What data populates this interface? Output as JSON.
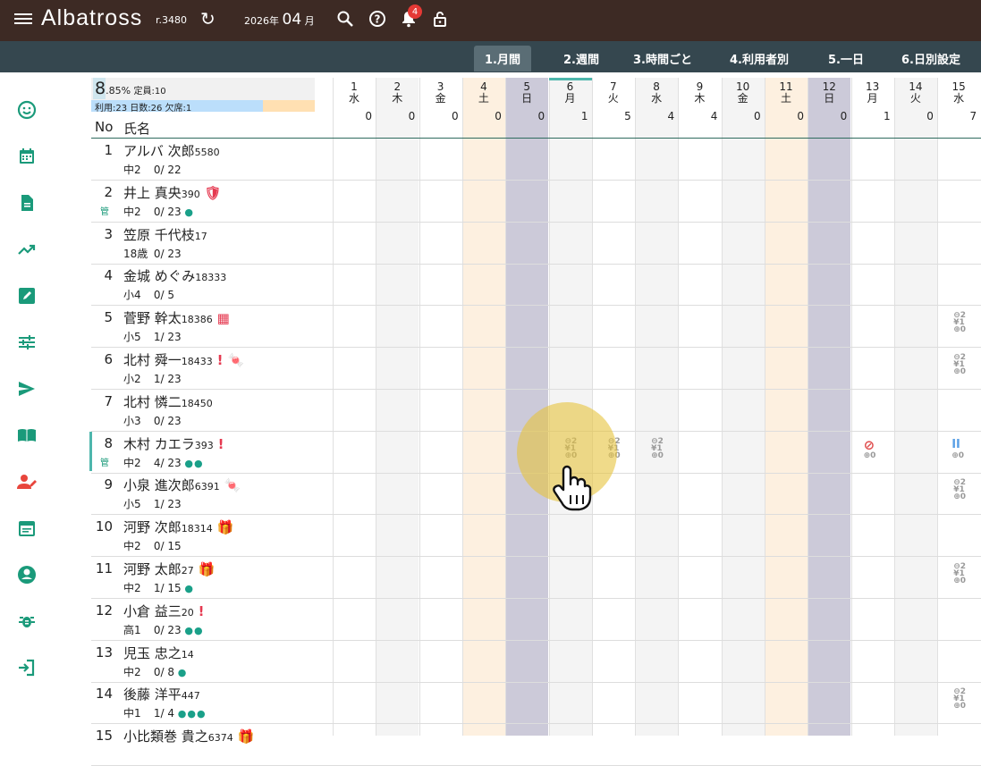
{
  "header": {
    "app_name": "Albatross",
    "revision": "r.3480",
    "year_label": "2026年",
    "month": "04",
    "month_suffix": "月",
    "notification_count": "4"
  },
  "tabs": [
    {
      "label": "1.月間"
    },
    {
      "label": "2.週間"
    },
    {
      "label": "3.時間ごと"
    },
    {
      "label": "4.利用者別"
    },
    {
      "label": "5.一日"
    },
    {
      "label": "6.日別設定"
    }
  ],
  "sidebar_icons": [
    "smile-icon",
    "calendar-icon",
    "document-icon",
    "trending-icon",
    "edit-icon",
    "tune-icon",
    "send-icon",
    "book-icon",
    "user-edit-icon",
    "event-note-icon",
    "account-circle-icon",
    "bug-icon",
    "login-icon"
  ],
  "summary": {
    "pct_big": "8",
    "pct_rest": ".85%",
    "capacity": "定員:10",
    "detail": "利用:23 日数:26 欠席:1"
  },
  "table_header": {
    "no": "No",
    "name": "氏名"
  },
  "days": [
    {
      "d": "1",
      "w": "水",
      "count": "0",
      "type": "normal"
    },
    {
      "d": "2",
      "w": "木",
      "count": "0",
      "type": "alt"
    },
    {
      "d": "3",
      "w": "金",
      "count": "0",
      "type": "normal"
    },
    {
      "d": "4",
      "w": "土",
      "count": "0",
      "type": "sat"
    },
    {
      "d": "5",
      "w": "日",
      "count": "0",
      "type": "sun"
    },
    {
      "d": "6",
      "w": "月",
      "count": "1",
      "type": "alt"
    },
    {
      "d": "7",
      "w": "火",
      "count": "5",
      "type": "normal"
    },
    {
      "d": "8",
      "w": "水",
      "count": "4",
      "type": "alt"
    },
    {
      "d": "9",
      "w": "木",
      "count": "4",
      "type": "normal"
    },
    {
      "d": "10",
      "w": "金",
      "count": "0",
      "type": "alt"
    },
    {
      "d": "11",
      "w": "土",
      "count": "0",
      "type": "sat"
    },
    {
      "d": "12",
      "w": "日",
      "count": "0",
      "type": "sun"
    },
    {
      "d": "13",
      "w": "月",
      "count": "1",
      "type": "normal"
    },
    {
      "d": "14",
      "w": "火",
      "count": "0",
      "type": "alt"
    },
    {
      "d": "15",
      "w": "水",
      "count": "7",
      "type": "normal"
    }
  ],
  "users": [
    {
      "no": "1",
      "name": "アルバ 次郎",
      "id": "5580",
      "grade": "中2",
      "used": "0/ 22",
      "kan": "",
      "extra": "",
      "dots": ""
    },
    {
      "no": "2",
      "name": "井上 真央",
      "id": "390",
      "grade": "中2",
      "used": "0/ 23",
      "kan": "管",
      "extra": "🛡",
      "dots": "●"
    },
    {
      "no": "3",
      "name": "笠原 千代枝",
      "id": "17",
      "grade": "18歳",
      "used": "0/ 23",
      "kan": "",
      "extra": "",
      "dots": ""
    },
    {
      "no": "4",
      "name": "金城 めぐみ",
      "id": "18333",
      "grade": "小4",
      "used": "0/  5",
      "kan": "",
      "extra": "",
      "dots": ""
    },
    {
      "no": "5",
      "name": "菅野 幹太",
      "id": "18386",
      "grade": "小5",
      "used": "1/ 23",
      "kan": "",
      "extra": "▦",
      "dots": ""
    },
    {
      "no": "6",
      "name": "北村 舜一",
      "id": "18433",
      "grade": "小2",
      "used": "1/ 23",
      "kan": "",
      "extra": "! 🍬",
      "dots": ""
    },
    {
      "no": "7",
      "name": "北村 憐二",
      "id": "18450",
      "grade": "小3",
      "used": "0/ 23",
      "kan": "",
      "extra": "",
      "dots": ""
    },
    {
      "no": "8",
      "name": "木村 カエラ",
      "id": "393",
      "grade": "中2",
      "used": "4/ 23",
      "kan": "管",
      "extra": "!",
      "dots": "●●"
    },
    {
      "no": "9",
      "name": "小泉 進次郎",
      "id": "6391",
      "grade": "小5",
      "used": "1/ 23",
      "kan": "",
      "extra": "🍬",
      "dots": ""
    },
    {
      "no": "10",
      "name": "河野 次郎",
      "id": "18314",
      "grade": "中2",
      "used": "0/ 15",
      "kan": "",
      "extra": "🎁",
      "dots": ""
    },
    {
      "no": "11",
      "name": "河野 太郎",
      "id": "27",
      "grade": "中2",
      "used": "1/ 15",
      "kan": "",
      "extra": "🎁",
      "dots": "●"
    },
    {
      "no": "12",
      "name": "小倉 益三",
      "id": "20",
      "grade": "高1",
      "used": "0/ 23",
      "kan": "",
      "extra": "!",
      "dots": "●●"
    },
    {
      "no": "13",
      "name": "児玉 忠之",
      "id": "14",
      "grade": "中2",
      "used": "0/  8",
      "kan": "",
      "extra": "",
      "dots": "●"
    },
    {
      "no": "14",
      "name": "後藤 洋平",
      "id": "447",
      "grade": "中1",
      "used": "1/  4",
      "kan": "",
      "extra": "",
      "dots": "●●●"
    },
    {
      "no": "15",
      "name": "小比類巻 貴之",
      "id": "6374",
      "grade": "",
      "used": "",
      "kan": "",
      "extra": "🎁",
      "dots": ""
    }
  ],
  "cell_marks": {
    "full": [
      "2",
      "1",
      "0"
    ],
    "plus_zero": "0",
    "cancel_symbol": "⃠",
    "pause_symbol": "II"
  },
  "colors": {
    "topbar": "#3d2a24",
    "tabbar": "#35474f",
    "accent": "#1a9a7a",
    "sunday": "#cccad9",
    "saturday": "#fdf0e0",
    "alt": "#f4f4f4"
  }
}
